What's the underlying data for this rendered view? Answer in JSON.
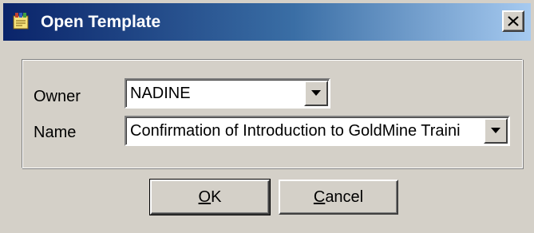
{
  "window": {
    "title": "Open Template",
    "icon": "template-app-icon",
    "close_icon": "close-icon"
  },
  "form": {
    "owner": {
      "label": "Owner",
      "value": "NADINE"
    },
    "name": {
      "label": "Name",
      "value": "Confirmation of Introduction to GoldMine Traini"
    }
  },
  "buttons": {
    "ok": {
      "mnemonic": "O",
      "rest": "K"
    },
    "cancel": {
      "mnemonic": "C",
      "rest": "ancel"
    }
  },
  "colors": {
    "titlebar_start": "#0a246a",
    "titlebar_end": "#a6caf0",
    "face": "#d4d0c8"
  }
}
